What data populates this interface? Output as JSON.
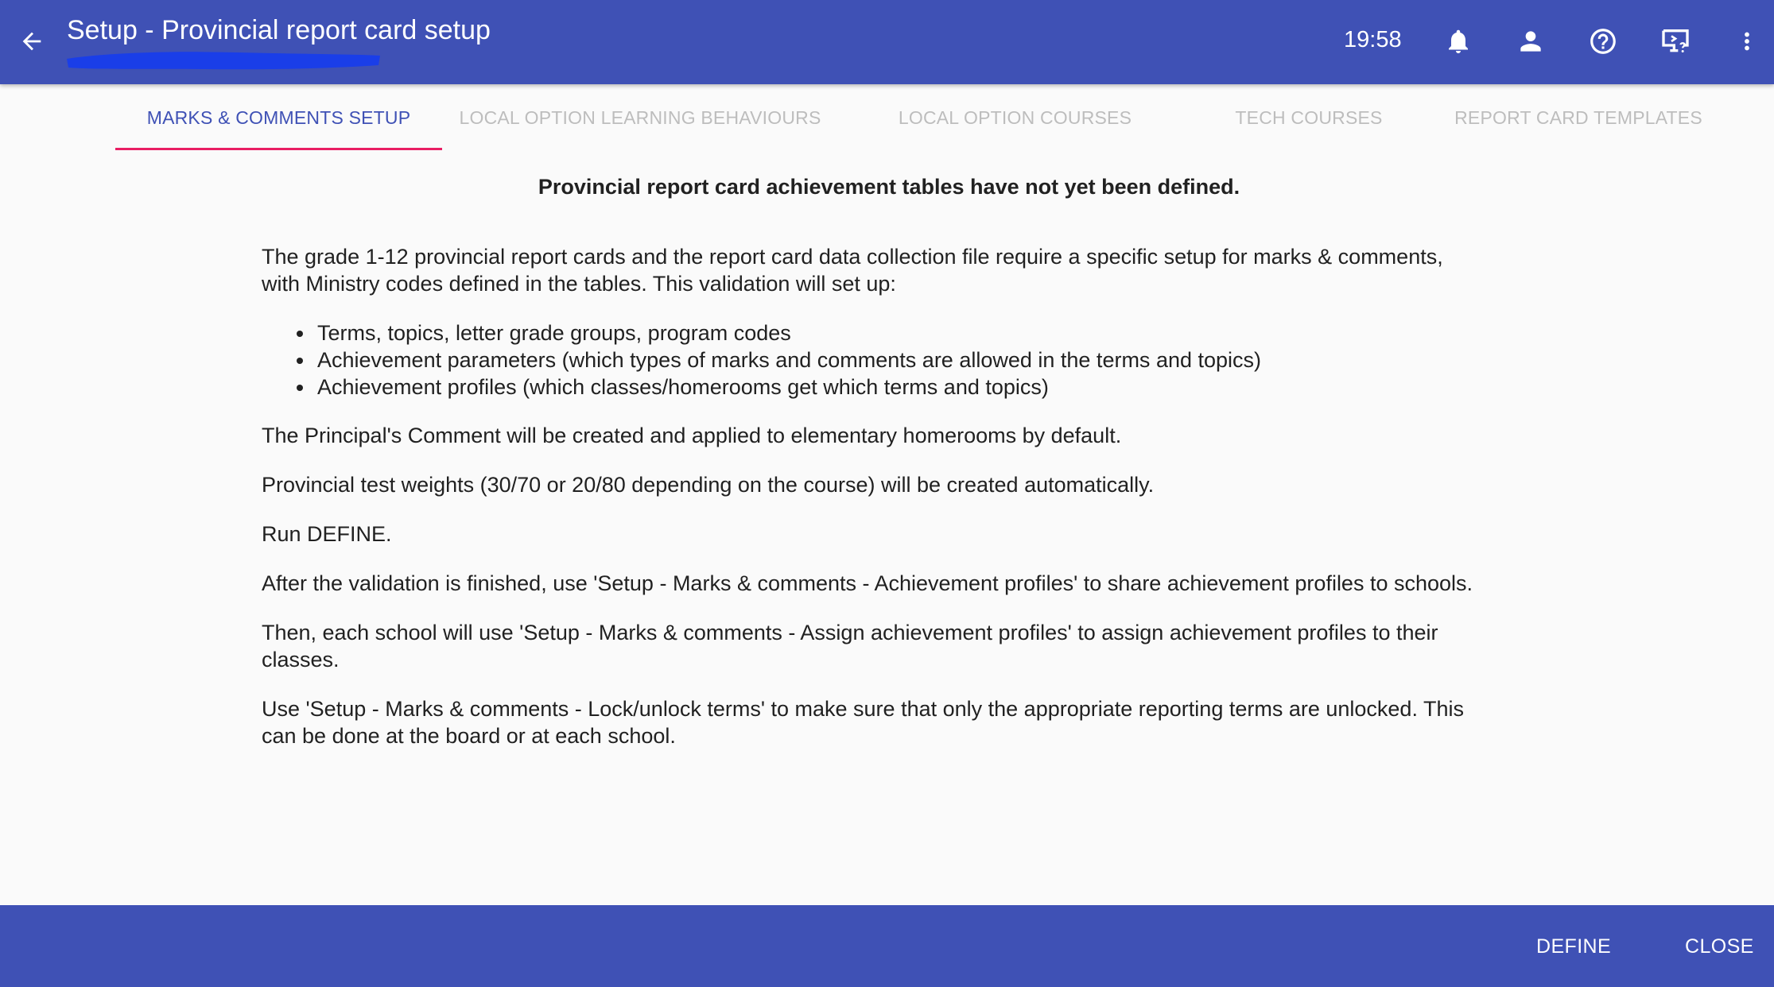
{
  "app_bar": {
    "title": "Setup - Provincial report card setup",
    "time": "19:58",
    "icons": [
      "back-arrow-icon",
      "bell-icon",
      "person-icon",
      "help-icon",
      "remote-desktop-icon",
      "more-vert-icon"
    ]
  },
  "tabs": [
    {
      "label": "MARKS & COMMENTS SETUP",
      "active": true
    },
    {
      "label": "LOCAL OPTION LEARNING BEHAVIOURS",
      "active": false
    },
    {
      "label": "LOCAL OPTION COURSES",
      "active": false
    },
    {
      "label": "TECH COURSES",
      "active": false
    },
    {
      "label": "REPORT CARD TEMPLATES",
      "active": false
    }
  ],
  "content": {
    "heading": "Provincial report card achievement tables have not yet been defined.",
    "intro_line1": "The grade 1-12 provincial report cards and the report card data collection file require a specific setup for marks & comments,",
    "intro_line2": "with Ministry codes defined in the tables. This validation will set up:",
    "bullets": [
      "Terms, topics, letter grade groups, program codes",
      "Achievement parameters (which types of marks and comments are allowed in the terms and topics)",
      "Achievement profiles (which classes/homerooms get which terms and topics)"
    ],
    "principal_comment": "The Principal's Comment will be created and applied to elementary homerooms by default.",
    "test_weights": "Provincial test weights (30/70 or 20/80 depending on the course) will be created automatically.",
    "run_define": "Run DEFINE.",
    "after_validation": "After the validation is finished, use 'Setup - Marks & comments - Achievement profiles' to share achievement profiles to schools.",
    "then_line1": "Then, each school will use 'Setup - Marks & comments - Assign achievement profiles' to assign achievement profiles to their",
    "then_line2": "classes.",
    "lock_line1": "Use 'Setup - Marks & comments - Lock/unlock terms' to make sure that only the appropriate reporting terms are unlocked. This",
    "lock_line2": "can be done at the board or at each school."
  },
  "bottom_bar": {
    "define_label": "DEFINE",
    "close_label": "CLOSE"
  },
  "colors": {
    "primary": "#3f51b5",
    "tab_indicator": "#e91e63",
    "inactive_tab": "#bdbdbd",
    "redaction": "#1a3ee8"
  }
}
